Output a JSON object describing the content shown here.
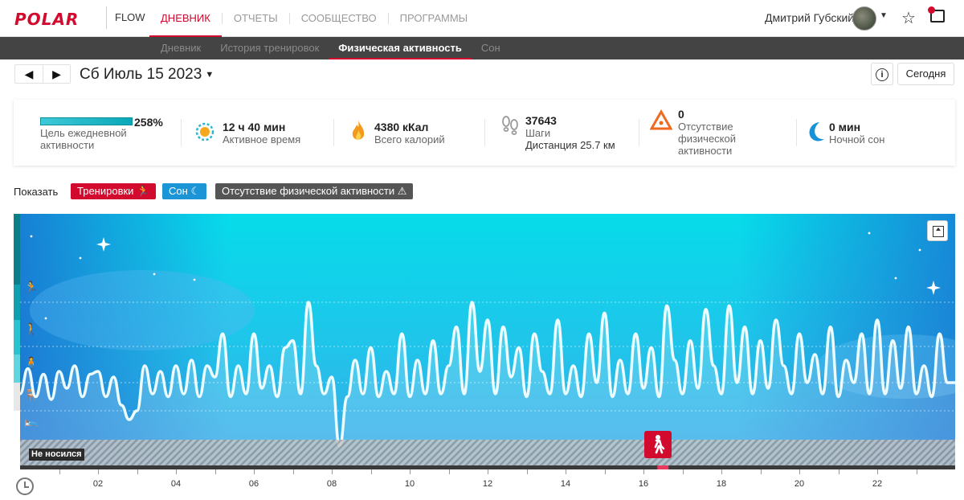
{
  "brand": {
    "logo": "POLAR",
    "product": "FLOW"
  },
  "topnav": [
    {
      "label": "ДНЕВНИК",
      "active": true
    },
    {
      "label": "ОТЧЕТЫ",
      "active": false
    },
    {
      "label": "СООБЩЕСТВО",
      "active": false
    },
    {
      "label": "ПРОГРАММЫ",
      "active": false
    }
  ],
  "user": {
    "name": "Дмитрий Губский"
  },
  "subnav": [
    {
      "label": "Дневник",
      "active": false
    },
    {
      "label": "История тренировок",
      "active": false
    },
    {
      "label": "Физическая активность",
      "active": true
    },
    {
      "label": "Сон",
      "active": false
    }
  ],
  "datebar": {
    "prev": "◀",
    "next": "▶",
    "date": "Сб Июль 15 2023",
    "info": "i",
    "today": "Сегодня"
  },
  "summary": {
    "goal": {
      "percent": "258%",
      "label": "Цель ежедневной активности",
      "fill": 1.0
    },
    "active_time": {
      "value": "12 ч 40 мин",
      "label": "Активное время"
    },
    "calories": {
      "value": "4380 кКал",
      "label": "Всего калорий"
    },
    "steps": {
      "value": "37643",
      "label": "Шаги",
      "distance": "Дистанция 25.7 км"
    },
    "inactivity": {
      "value": "0",
      "label": "Отсутствие физической активности"
    },
    "sleep": {
      "value": "0 мин",
      "label": "Ночной сон"
    }
  },
  "show": {
    "label": "Показать",
    "tags": [
      {
        "label": "Тренировки",
        "color": "#d10a2e"
      },
      {
        "label": "Сон",
        "color": "#1b95d6"
      },
      {
        "label": "Отсутствие физической активности",
        "color": "#555555"
      }
    ]
  },
  "chart": {
    "not_worn_label": "Не носился",
    "icons": [
      "running-icon",
      "walking-icon",
      "standing-icon",
      "sitting-icon",
      "lying-icon"
    ],
    "colors": {
      "sky_top": "#08dbe9",
      "sky_bottom": "#3aa6e8",
      "curve": "#e9fbfd",
      "marker": "#d10a2e"
    }
  },
  "chart_data": {
    "type": "area",
    "x_ticks": [
      "02",
      "04",
      "06",
      "08",
      "10",
      "12",
      "14",
      "16",
      "18",
      "20",
      "22"
    ],
    "xlim": [
      0,
      24
    ],
    "levels": [
      "not-worn",
      "lying",
      "sitting",
      "standing",
      "walking",
      "running"
    ],
    "series": [
      {
        "x": [
          0.0,
          0.2,
          0.4,
          0.6,
          0.8,
          1.0,
          1.2,
          1.4,
          1.6,
          1.8,
          2.0,
          2.2,
          2.4,
          2.6,
          2.8,
          3.0,
          3.2,
          3.4,
          3.6,
          3.8,
          4.0,
          4.2,
          4.4,
          4.6,
          4.8,
          5.0,
          5.2,
          5.4,
          5.6,
          5.8,
          6.0,
          6.2,
          6.4,
          6.6,
          6.8,
          7.0,
          7.2,
          7.4,
          7.6,
          7.8,
          8.0,
          8.2,
          8.4,
          8.6,
          8.8,
          9.0,
          9.2,
          9.4,
          9.6,
          9.8,
          10.0,
          10.2,
          10.4,
          10.6,
          10.8,
          11.0,
          11.2,
          11.4,
          11.6,
          11.8,
          12.0,
          12.2,
          12.4,
          12.6,
          12.8,
          13.0,
          13.2,
          13.4,
          13.6,
          13.8,
          14.0,
          14.2,
          14.4,
          14.6,
          14.8,
          15.0,
          15.2,
          15.4,
          15.6,
          15.8,
          16.0,
          16.2,
          16.4,
          16.6,
          16.8,
          17.0,
          17.2,
          17.4,
          17.6,
          17.8,
          18.0,
          18.2,
          18.4,
          18.6,
          18.8,
          19.0,
          19.2,
          19.4,
          19.6,
          19.8,
          20.0,
          20.2,
          20.4,
          20.6,
          20.8,
          21.0,
          21.2,
          21.4,
          21.6,
          21.8,
          22.0,
          22.2,
          22.4,
          22.6,
          22.8,
          23.0,
          23.2,
          23.4,
          23.6,
          23.8
        ],
        "y": [
          1.6,
          2.5,
          1.5,
          2.3,
          1.4,
          2.4,
          1.8,
          2.6,
          1.5,
          2.3,
          2.4,
          1.5,
          2.2,
          1.2,
          0.8,
          1.0,
          2.6,
          1.6,
          2.4,
          1.5,
          2.6,
          1.6,
          2.8,
          1.5,
          2.6,
          2.2,
          3.6,
          1.5,
          2.6,
          1.6,
          3.6,
          1.8,
          2.6,
          1.5,
          3.2,
          3.4,
          1.6,
          4.5,
          2.6,
          1.6,
          2.2,
          0.2,
          1.5,
          2.8,
          1.6,
          3.2,
          1.5,
          2.4,
          1.6,
          3.6,
          1.5,
          2.8,
          1.6,
          3.4,
          1.6,
          2.6,
          3.8,
          1.6,
          4.5,
          2.4,
          4.0,
          1.6,
          3.8,
          2.2,
          3.2,
          1.5,
          3.6,
          2.4,
          1.6,
          4.0,
          1.6,
          2.6,
          1.5,
          3.6,
          2.0,
          4.2,
          1.5,
          2.8,
          1.6,
          3.6,
          1.8,
          3.2,
          1.5,
          4.4,
          2.8,
          1.6,
          3.4,
          1.8,
          4.3,
          2.6,
          1.6,
          4.4,
          2.0,
          3.8,
          1.6,
          3.4,
          1.8,
          4.0,
          2.6,
          1.6,
          3.6,
          2.0,
          3.0,
          1.6,
          3.8,
          1.5,
          2.8,
          2.0,
          3.6,
          1.6,
          4.0,
          1.6,
          3.4,
          1.8,
          3.8,
          1.6,
          2.6,
          1.5,
          3.6,
          2.0
        ]
      }
    ],
    "events": [
      {
        "type": "training",
        "x": 16.5
      }
    ]
  }
}
